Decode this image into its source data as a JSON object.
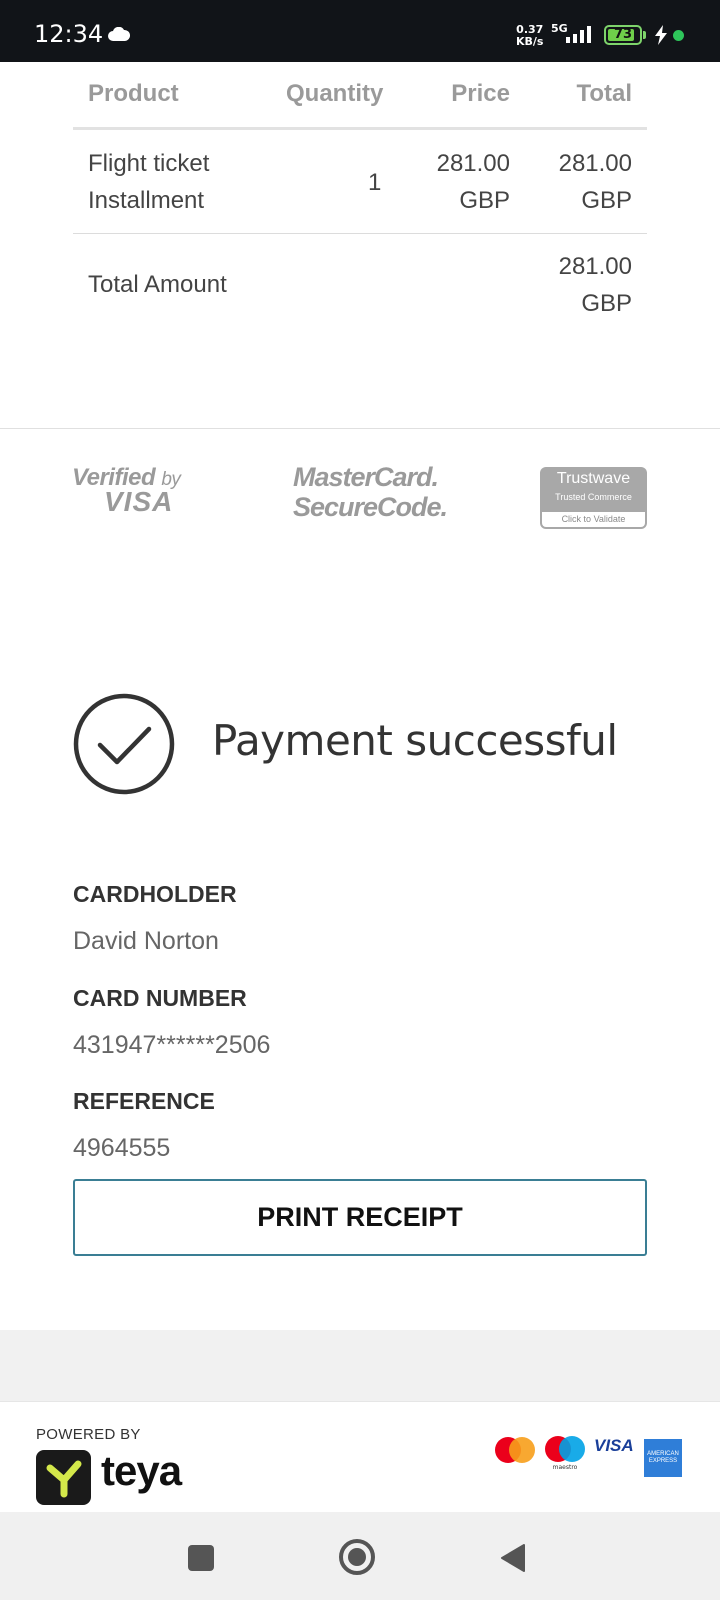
{
  "status_bar": {
    "time": "12:34",
    "net_speed_value": "0.37",
    "net_speed_unit": "KB/s",
    "network_type": "5G",
    "battery": "73"
  },
  "order": {
    "headers": {
      "product": "Product",
      "quantity": "Quantity",
      "price": "Price",
      "total": "Total"
    },
    "rows": [
      {
        "product_line1": "Flight ticket",
        "product_line2": "Installment",
        "quantity": "1",
        "price_amount": "281.00",
        "price_currency": "GBP",
        "total_amount": "281.00",
        "total_currency": "GBP"
      }
    ],
    "footer": {
      "label": "Total Amount",
      "amount": "281.00",
      "currency": "GBP"
    }
  },
  "security_logos": {
    "visa_l1": "Verified",
    "visa_by": "by",
    "visa_l2": "VISA",
    "mc_l1": "MasterCard.",
    "mc_l2": "SecureCode.",
    "trustwave_name": "Trustwave",
    "trustwave_sub": "Trusted Commerce",
    "trustwave_action": "Click to Validate"
  },
  "payment": {
    "status": "Payment successful",
    "cardholder_label": "CARDHOLDER",
    "cardholder_value": "David Norton",
    "card_number_label": "CARD NUMBER",
    "card_number_value": "431947******2506",
    "reference_label": "REFERENCE",
    "reference_value": "4964555",
    "print_button": "PRINT RECEIPT"
  },
  "footer": {
    "powered_by": "POWERED BY",
    "brand": "teya",
    "card_brands": {
      "maestro": "maestro",
      "visa": "VISA",
      "amex": "AMERICAN EXPRESS"
    }
  },
  "colors": {
    "status_bar_bg": "#111418",
    "button_border": "#3a7e94",
    "battery_green": "#6fcf4a",
    "visa_blue": "#1a3f99",
    "amex_blue": "#2f7ed8"
  },
  "icons": [
    "cloud-icon",
    "signal-icon",
    "battery-icon",
    "charging-icon",
    "check-circle-icon",
    "recents-nav-icon",
    "home-nav-icon",
    "back-nav-icon"
  ]
}
